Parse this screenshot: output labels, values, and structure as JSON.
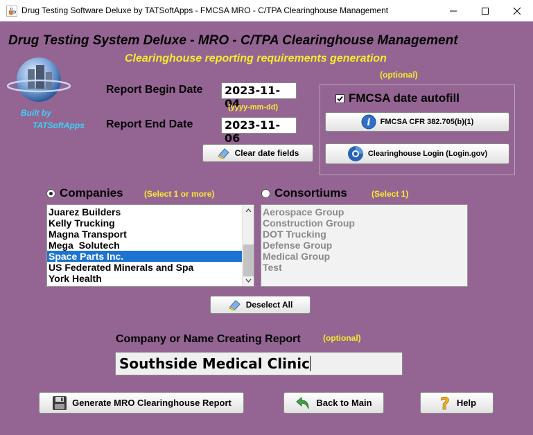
{
  "window": {
    "title": "Drug Testing Software Deluxe by TATSoftApps - FMCSA MRO - C/TPA Clearinghouse Management",
    "icon": "java-cup-icon"
  },
  "header": {
    "title": "Drug Testing System Deluxe - MRO - C/TPA Clearinghouse Management",
    "subtitle": "Clearinghouse reporting requirements generation",
    "built_by_1": "Built by",
    "built_by_2": "TATSoftApps"
  },
  "dates": {
    "begin_label": "Report Begin Date",
    "begin_value": "2023-11-04",
    "format_hint": "(yyyy-mm-dd)",
    "end_label": "Report End Date",
    "end_value": "2023-11-06",
    "clear_label": "Clear date fields"
  },
  "fmcsa": {
    "optional_label": "(optional)",
    "autofill_label": "FMCSA date autofill",
    "autofill_checked": true,
    "cfr_button": "FMCSA CFR 382.705(b)(1)",
    "login_button": "Clearinghouse Login (Login.gov)"
  },
  "companies": {
    "label": "Companies",
    "hint": "(Select 1 or more)",
    "selected_radio": true,
    "items": [
      "Juarez Builders",
      "Kelly Trucking",
      "Magna Transport",
      "Mega  Solutech",
      "Space Parts Inc.",
      "US Federated Minerals and Spa",
      "York Health"
    ],
    "selected_index": 4
  },
  "consortiums": {
    "label": "Consortiums",
    "hint": "(Select 1)",
    "items": [
      "Aerospace Group",
      "Construction Group",
      "DOT Trucking",
      "Defense Group",
      "Medical Group",
      "Test"
    ]
  },
  "deselect_label": "Deselect All",
  "creator": {
    "label": "Company or Name Creating Report",
    "optional": "(optional)",
    "value": "Southside Medical Clinic"
  },
  "footer": {
    "generate": "Generate MRO Clearinghouse Report",
    "back": "Back to Main",
    "help": "Help"
  },
  "colors": {
    "background": "#946593",
    "accent_yellow": "#f7ea2e",
    "built_by_cyan": "#39d3f7",
    "selection": "#1c73d1"
  }
}
